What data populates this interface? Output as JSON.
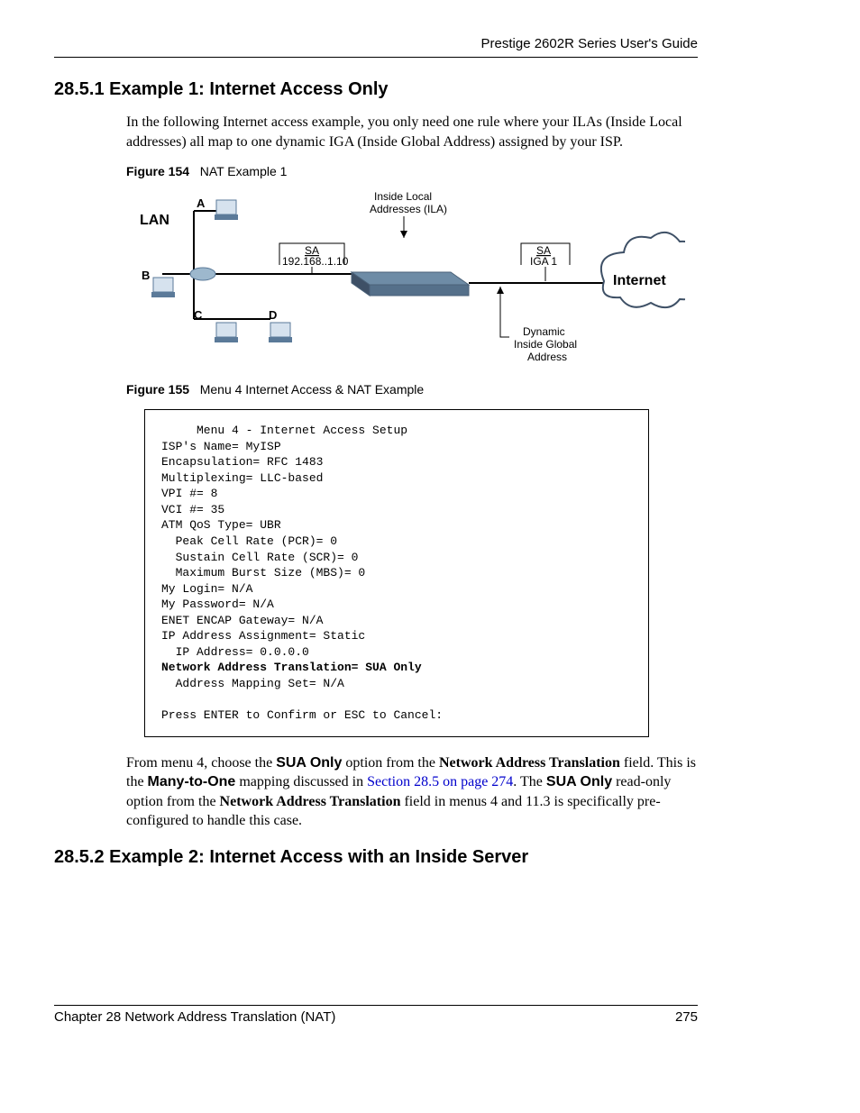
{
  "header": {
    "guide": "Prestige 2602R Series User's Guide"
  },
  "section1": {
    "heading": "28.5.1  Example 1: Internet Access Only",
    "paragraph": "In the following Internet access example, you only need one rule where your ILAs (Inside Local addresses) all map to one dynamic IGA (Inside Global Address) assigned by your ISP."
  },
  "figure154": {
    "label": "Figure 154",
    "title": "NAT Example 1",
    "diagram": {
      "lan": "LAN",
      "internet": "Internet",
      "ila_title_line1": "Inside Local",
      "ila_title_line2": "Addresses (ILA)",
      "sa_left_top": "SA",
      "sa_left_bottom": "192.168..1.10",
      "sa_right_top": "SA",
      "sa_right_bottom": "IGA 1",
      "dyn1": "Dynamic",
      "dyn2": "Inside Global",
      "dyn3": "Address",
      "node_a": "A",
      "node_b": "B",
      "node_c": "C",
      "node_d": "D"
    }
  },
  "figure155": {
    "label": "Figure 155",
    "title": "Menu 4 Internet Access & NAT Example"
  },
  "terminal": {
    "menu_title": "     Menu 4 - Internet Access Setup",
    "l1": "ISP's Name= MyISP",
    "l2": "Encapsulation= RFC 1483",
    "l3": "Multiplexing= LLC-based",
    "l4": "VPI #= 8",
    "l5": "VCI #= 35",
    "l6": "ATM QoS Type= UBR",
    "l7": "  Peak Cell Rate (PCR)= 0",
    "l8": "  Sustain Cell Rate (SCR)= 0",
    "l9": "  Maximum Burst Size (MBS)= 0",
    "l10": "My Login= N/A",
    "l11": "My Password= N/A",
    "l12": "ENET ENCAP Gateway= N/A",
    "l13": "IP Address Assignment= Static",
    "l14": "  IP Address= 0.0.0.0",
    "l15": "Network Address Translation= SUA Only",
    "l16": "  Address Mapping Set= N/A",
    "l17": "",
    "l18": "Press ENTER to Confirm or ESC to Cancel:"
  },
  "post_terminal": {
    "t1": "From menu 4, choose the ",
    "t2": "SUA Only",
    "t3": " option from the ",
    "t4": "Network Address Translation",
    "t5": " field. This is the ",
    "t6": "Many-to-One",
    "t7": " mapping discussed in ",
    "t8": "Section 28.5 on page 274",
    "t9": ". The ",
    "t10": "SUA Only",
    "t11": " read-only option from the ",
    "t12": "Network Address Translation",
    "t13": " field in menus 4 and 11.3 is specifically pre-configured to handle this case."
  },
  "section2": {
    "heading": "28.5.2  Example 2: Internet Access with an Inside Server"
  },
  "footer": {
    "chapter": "Chapter 28 Network Address Translation (NAT)",
    "page": "275"
  }
}
